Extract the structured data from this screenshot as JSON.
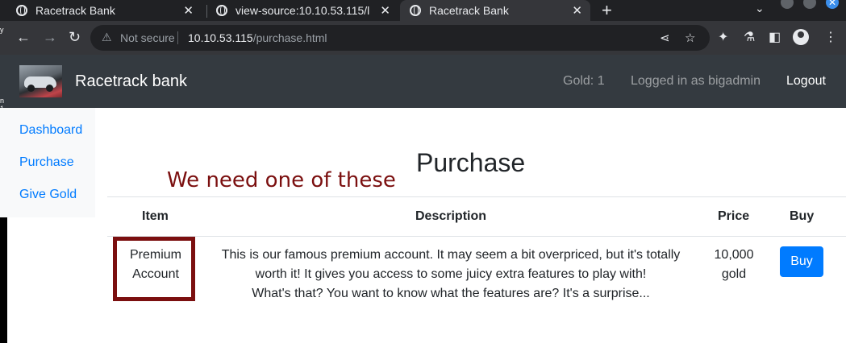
{
  "browser": {
    "tabs": [
      {
        "title": "Racetrack Bank"
      },
      {
        "title": "view-source:10.10.53.115/l"
      },
      {
        "title": "Racetrack Bank"
      }
    ],
    "new_tab": "+",
    "security_label": "Not secure",
    "url_host": "10.10.53.115",
    "url_path": "/purchase.html"
  },
  "navbar": {
    "brand": "Racetrack bank",
    "gold": "Gold: 1",
    "logged_in": "Logged in as bigadmin",
    "logout": "Logout"
  },
  "sidebar": {
    "items": [
      {
        "label": "Dashboard"
      },
      {
        "label": "Purchase"
      },
      {
        "label": "Give Gold"
      }
    ]
  },
  "main": {
    "title": "Purchase",
    "annotation": "We need one of these",
    "table": {
      "headers": [
        "Item",
        "Description",
        "Price",
        "Buy"
      ],
      "rows": [
        {
          "item_line1": "Premium",
          "item_line2": "Account",
          "desc_line1": "This is our famous premium account. It may seem a bit overpriced, but it's totally",
          "desc_line2": "worth it! It gives you access to some juicy extra features to play with!",
          "desc_line3": "What's that? You want to know what the features are? It's a surprise...",
          "price_line1": "10,000",
          "price_line2": "gold",
          "buy_label": "Buy"
        }
      ]
    }
  },
  "colors": {
    "navbar_bg": "#343a40",
    "link": "#007bff",
    "annotation": "#7b0f0f",
    "button": "#007bff"
  }
}
